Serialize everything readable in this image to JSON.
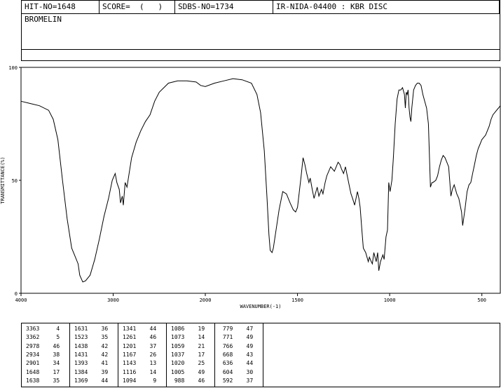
{
  "header": {
    "hit_no": "HIT-NO=1648",
    "score": "SCORE=  (   )",
    "sdbs_no": "SDBS-NO=1734",
    "ir_info": "IR-NIDA-04400 : KBR DISC"
  },
  "sample_name": "BROMELIN",
  "chart_data": {
    "type": "line",
    "xlabel": "WAVENUMBER(-1)",
    "ylabel": "TRANSMITTANCE(%)",
    "xlim": [
      4000,
      400
    ],
    "ylim": [
      0,
      100
    ],
    "x_ticks": [
      4000,
      3000,
      2000,
      1500,
      1000,
      500
    ],
    "y_ticks": [
      0,
      50,
      100
    ],
    "x_tick_labels": [
      "4000",
      "3000",
      "2000",
      "1500",
      "1000",
      "500"
    ],
    "y_tick_labels": [
      "0",
      "50",
      "100"
    ],
    "series": [
      {
        "color": "#000000",
        "points": [
          [
            4000,
            85
          ],
          [
            3900,
            84
          ],
          [
            3800,
            83
          ],
          [
            3700,
            81
          ],
          [
            3650,
            77
          ],
          [
            3600,
            68
          ],
          [
            3550,
            50
          ],
          [
            3500,
            33
          ],
          [
            3450,
            20
          ],
          [
            3420,
            17
          ],
          [
            3380,
            13
          ],
          [
            3363,
            8
          ],
          [
            3330,
            5
          ],
          [
            3300,
            5.5
          ],
          [
            3250,
            8
          ],
          [
            3200,
            15
          ],
          [
            3150,
            24
          ],
          [
            3100,
            34
          ],
          [
            3050,
            42
          ],
          [
            3010,
            50
          ],
          [
            2978,
            53
          ],
          [
            2960,
            49
          ],
          [
            2934,
            46
          ],
          [
            2920,
            40
          ],
          [
            2901,
            43
          ],
          [
            2890,
            39
          ],
          [
            2870,
            49
          ],
          [
            2850,
            47
          ],
          [
            2800,
            60
          ],
          [
            2750,
            67
          ],
          [
            2700,
            72
          ],
          [
            2650,
            76
          ],
          [
            2600,
            79
          ],
          [
            2550,
            85
          ],
          [
            2500,
            89
          ],
          [
            2450,
            91
          ],
          [
            2400,
            93
          ],
          [
            2300,
            94
          ],
          [
            2200,
            94
          ],
          [
            2100,
            93.5
          ],
          [
            2050,
            92
          ],
          [
            2000,
            91.5
          ],
          [
            1950,
            93
          ],
          [
            1900,
            94
          ],
          [
            1850,
            95
          ],
          [
            1800,
            94.5
          ],
          [
            1750,
            93
          ],
          [
            1720,
            88
          ],
          [
            1700,
            80
          ],
          [
            1680,
            63
          ],
          [
            1665,
            42
          ],
          [
            1655,
            26
          ],
          [
            1648,
            19
          ],
          [
            1638,
            18
          ],
          [
            1631,
            20
          ],
          [
            1620,
            26
          ],
          [
            1600,
            37
          ],
          [
            1580,
            45
          ],
          [
            1560,
            44
          ],
          [
            1540,
            40
          ],
          [
            1523,
            37
          ],
          [
            1510,
            36
          ],
          [
            1500,
            38
          ],
          [
            1490,
            45
          ],
          [
            1480,
            52
          ],
          [
            1470,
            60
          ],
          [
            1460,
            57
          ],
          [
            1450,
            53
          ],
          [
            1438,
            49
          ],
          [
            1431,
            51
          ],
          [
            1420,
            46
          ],
          [
            1410,
            42
          ],
          [
            1393,
            47
          ],
          [
            1384,
            43
          ],
          [
            1370,
            46
          ],
          [
            1362,
            44
          ],
          [
            1350,
            49
          ],
          [
            1341,
            52
          ],
          [
            1320,
            56
          ],
          [
            1300,
            54
          ],
          [
            1280,
            58
          ],
          [
            1270,
            57
          ],
          [
            1261,
            55
          ],
          [
            1250,
            53
          ],
          [
            1240,
            56
          ],
          [
            1230,
            52
          ],
          [
            1220,
            48
          ],
          [
            1210,
            44
          ],
          [
            1201,
            42
          ],
          [
            1190,
            39
          ],
          [
            1175,
            45
          ],
          [
            1167,
            42
          ],
          [
            1160,
            38
          ],
          [
            1150,
            27
          ],
          [
            1143,
            20
          ],
          [
            1130,
            18
          ],
          [
            1116,
            14
          ],
          [
            1110,
            16
          ],
          [
            1100,
            14
          ],
          [
            1094,
            13
          ],
          [
            1086,
            18
          ],
          [
            1073,
            14
          ],
          [
            1065,
            18
          ],
          [
            1059,
            10
          ],
          [
            1050,
            14
          ],
          [
            1037,
            17
          ],
          [
            1030,
            15
          ],
          [
            1020,
            25
          ],
          [
            1012,
            28
          ],
          [
            1005,
            49
          ],
          [
            998,
            45
          ],
          [
            988,
            50
          ],
          [
            980,
            60
          ],
          [
            970,
            75
          ],
          [
            960,
            86
          ],
          [
            950,
            90
          ],
          [
            940,
            90
          ],
          [
            930,
            91
          ],
          [
            920,
            88
          ],
          [
            915,
            82
          ],
          [
            910,
            89
          ],
          [
            905,
            88
          ],
          [
            900,
            90
          ],
          [
            895,
            82
          ],
          [
            890,
            78
          ],
          [
            885,
            76
          ],
          [
            880,
            82
          ],
          [
            870,
            90
          ],
          [
            860,
            92
          ],
          [
            850,
            93
          ],
          [
            840,
            93
          ],
          [
            830,
            92
          ],
          [
            820,
            88
          ],
          [
            810,
            85
          ],
          [
            800,
            82
          ],
          [
            790,
            75
          ],
          [
            779,
            47
          ],
          [
            771,
            49
          ],
          [
            766,
            49
          ],
          [
            750,
            50
          ],
          [
            740,
            52
          ],
          [
            730,
            56
          ],
          [
            720,
            59
          ],
          [
            710,
            61
          ],
          [
            700,
            60
          ],
          [
            690,
            58
          ],
          [
            680,
            56
          ],
          [
            668,
            43
          ],
          [
            660,
            46
          ],
          [
            650,
            48
          ],
          [
            636,
            44
          ],
          [
            625,
            42
          ],
          [
            610,
            36
          ],
          [
            604,
            30
          ],
          [
            592,
            37
          ],
          [
            580,
            45
          ],
          [
            570,
            48
          ],
          [
            560,
            49
          ],
          [
            550,
            53
          ],
          [
            540,
            57
          ],
          [
            530,
            61
          ],
          [
            520,
            64
          ],
          [
            510,
            66
          ],
          [
            500,
            68
          ],
          [
            490,
            69
          ],
          [
            480,
            70
          ],
          [
            470,
            72
          ],
          [
            460,
            74
          ],
          [
            450,
            77
          ],
          [
            440,
            79
          ],
          [
            430,
            80
          ],
          [
            420,
            81
          ],
          [
            410,
            82
          ],
          [
            400,
            83
          ]
        ]
      }
    ]
  },
  "peak_table": [
    [
      [
        3363,
        4
      ],
      [
        3362,
        5
      ],
      [
        2978,
        46
      ],
      [
        2934,
        38
      ],
      [
        2901,
        34
      ],
      [
        1648,
        17
      ],
      [
        1638,
        35
      ]
    ],
    [
      [
        1631,
        36
      ],
      [
        1523,
        35
      ],
      [
        1438,
        42
      ],
      [
        1431,
        42
      ],
      [
        1393,
        41
      ],
      [
        1384,
        39
      ],
      [
        1369,
        44
      ]
    ],
    [
      [
        1341,
        44
      ],
      [
        1261,
        46
      ],
      [
        1201,
        37
      ],
      [
        1167,
        26
      ],
      [
        1143,
        13
      ],
      [
        1116,
        14
      ],
      [
        1094,
        9
      ]
    ],
    [
      [
        1086,
        19
      ],
      [
        1073,
        14
      ],
      [
        1059,
        21
      ],
      [
        1037,
        17
      ],
      [
        1020,
        25
      ],
      [
        1005,
        49
      ],
      [
        988,
        46
      ]
    ],
    [
      [
        779,
        47
      ],
      [
        771,
        49
      ],
      [
        766,
        49
      ],
      [
        668,
        43
      ],
      [
        636,
        44
      ],
      [
        604,
        30
      ],
      [
        592,
        37
      ]
    ]
  ]
}
